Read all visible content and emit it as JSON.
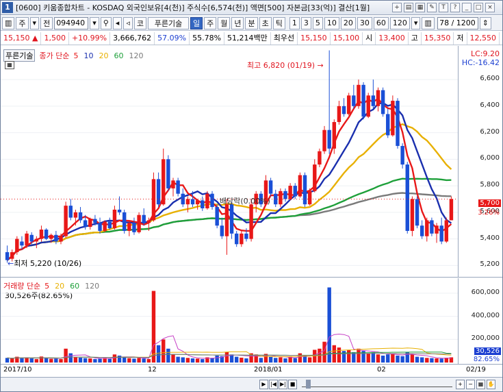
{
  "window": {
    "number": "1",
    "title": "[0600] 키움종합차트 - KOSDAQ 외국인보유[4(천)] 주식수[6,574(천)] 액면[500] 자본금[33(억)] 결산[1월]"
  },
  "toolbar": {
    "market_btn": "주",
    "prev_btn": "전",
    "code": "094940",
    "code_prefix": "코",
    "stock_name": "푸른기술",
    "period_buttons": [
      "일",
      "주",
      "월",
      "년",
      "분",
      "초",
      "틱"
    ],
    "interval_buttons": [
      "1",
      "3",
      "5",
      "10",
      "20",
      "30",
      "60",
      "120"
    ],
    "selected_period": "일",
    "page": "78 / 1200"
  },
  "quote": {
    "price": "15,150",
    "change": "1,500",
    "change_pct": "+10.99%",
    "volume": "3,666,762",
    "vol_ratio1": "57.09%",
    "vol_ratio2": "55.78%",
    "amount": "51,214백만",
    "best_ask_label": "최우선",
    "best_ask": "15,150",
    "best_bid": "15,100",
    "open_label": "시",
    "open": "13,400",
    "high_label": "고",
    "high": "15,350",
    "low_label": "저",
    "low": "12,550"
  },
  "price_pane": {
    "legend_box": "푸른기술",
    "legend_title": "종가 단순",
    "ma_periods": [
      "5",
      "10",
      "20",
      "60",
      "120"
    ],
    "ma_colors": [
      "#e81818",
      "#1a2fae",
      "#e8b000",
      "#1ea03a",
      "#7a7a7a"
    ],
    "lc_label": "LC:9.20",
    "hc_label": "HC:-16.42",
    "high_marker": "최고 6,820 (01/19)",
    "low_marker": "최저 5,220 (10/26)",
    "dividend_marker": "배당락(0.00%)",
    "current_price_tag": "5,700",
    "current_pct_tag": "3.26%",
    "y_ticks": [
      "6,600",
      "6,400",
      "6,200",
      "6,000",
      "5,800",
      "5,600",
      "5,400",
      "5,200"
    ]
  },
  "volume_pane": {
    "legend_title": "거래량 단순",
    "ma_periods": [
      "5",
      "20",
      "60",
      "120"
    ],
    "current_text": "30,526주(82.65%)",
    "current_tag": "30,526",
    "pct_tag": "82.65%",
    "y_ticks": [
      "600,000",
      "400,000",
      "200,000"
    ]
  },
  "x_axis": {
    "labels": [
      "2017/10",
      "12",
      "2018/01",
      "02",
      "02/19"
    ]
  },
  "chart_data": {
    "type": "candlestick",
    "ylim": [
      5150,
      6750
    ],
    "volume_ylim": [
      0,
      700000
    ],
    "candles": [
      [
        5300,
        5350,
        5220,
        5240,
        40000
      ],
      [
        5250,
        5320,
        5230,
        5300,
        35000
      ],
      [
        5300,
        5420,
        5280,
        5400,
        50000
      ],
      [
        5380,
        5420,
        5320,
        5350,
        38000
      ],
      [
        5350,
        5460,
        5330,
        5440,
        45000
      ],
      [
        5430,
        5450,
        5360,
        5380,
        36000
      ],
      [
        5380,
        5420,
        5330,
        5400,
        30000
      ],
      [
        5400,
        5500,
        5380,
        5470,
        52000
      ],
      [
        5470,
        5480,
        5390,
        5400,
        40000
      ],
      [
        5400,
        5440,
        5370,
        5430,
        32000
      ],
      [
        5430,
        5460,
        5360,
        5380,
        34000
      ],
      [
        5380,
        5440,
        5360,
        5420,
        30000
      ],
      [
        5420,
        5680,
        5410,
        5650,
        120000
      ],
      [
        5650,
        5700,
        5540,
        5560,
        80000
      ],
      [
        5560,
        5620,
        5500,
        5600,
        50000
      ],
      [
        5600,
        5640,
        5520,
        5540,
        42000
      ],
      [
        5540,
        5580,
        5470,
        5490,
        38000
      ],
      [
        5490,
        5560,
        5470,
        5550,
        36000
      ],
      [
        5550,
        5580,
        5500,
        5520,
        30000
      ],
      [
        5520,
        5560,
        5440,
        5460,
        34000
      ],
      [
        5460,
        5540,
        5450,
        5530,
        40000
      ],
      [
        5530,
        5560,
        5470,
        5480,
        32000
      ],
      [
        5480,
        5650,
        5470,
        5620,
        70000
      ],
      [
        5620,
        5720,
        5580,
        5600,
        60000
      ],
      [
        5600,
        5620,
        5440,
        5460,
        45000
      ],
      [
        5460,
        5540,
        5420,
        5520,
        38000
      ],
      [
        5520,
        5560,
        5430,
        5450,
        34000
      ],
      [
        5450,
        5600,
        5440,
        5580,
        40000
      ],
      [
        5580,
        5630,
        5500,
        5520,
        35000
      ],
      [
        5520,
        5560,
        5460,
        5540,
        30000
      ],
      [
        5540,
        5900,
        5530,
        5850,
        620000
      ],
      [
        5850,
        5900,
        5640,
        5660,
        150000
      ],
      [
        5660,
        6080,
        5650,
        6000,
        200000
      ],
      [
        6000,
        6030,
        5760,
        5780,
        120000
      ],
      [
        5780,
        5860,
        5720,
        5840,
        70000
      ],
      [
        5840,
        5860,
        5720,
        5740,
        50000
      ],
      [
        5740,
        5780,
        5640,
        5660,
        45000
      ],
      [
        5660,
        5720,
        5600,
        5700,
        40000
      ],
      [
        5700,
        5760,
        5640,
        5660,
        36000
      ],
      [
        5660,
        5700,
        5620,
        5690,
        34000
      ],
      [
        5690,
        5720,
        5610,
        5630,
        30000
      ],
      [
        5630,
        5760,
        5620,
        5740,
        45000
      ],
      [
        5740,
        5760,
        5620,
        5640,
        40000
      ],
      [
        5640,
        5660,
        5480,
        5500,
        60000
      ],
      [
        5500,
        5560,
        5400,
        5420,
        55000
      ],
      [
        5420,
        5700,
        5280,
        5660,
        90000
      ],
      [
        5660,
        5680,
        5400,
        5440,
        70000
      ],
      [
        5440,
        5460,
        5340,
        5360,
        50000
      ],
      [
        5360,
        5460,
        5340,
        5440,
        42000
      ],
      [
        5440,
        5480,
        5380,
        5400,
        36000
      ],
      [
        5400,
        5700,
        5380,
        5660,
        80000
      ],
      [
        5660,
        5760,
        5600,
        5740,
        70000
      ],
      [
        5740,
        5760,
        5640,
        5660,
        40000
      ],
      [
        5660,
        5880,
        5650,
        5840,
        75000
      ],
      [
        5840,
        5860,
        5720,
        5740,
        50000
      ],
      [
        5740,
        5770,
        5640,
        5660,
        40000
      ],
      [
        5660,
        5780,
        5640,
        5760,
        45000
      ],
      [
        5760,
        5780,
        5680,
        5700,
        36000
      ],
      [
        5700,
        5820,
        5690,
        5800,
        50000
      ],
      [
        5800,
        5820,
        5700,
        5720,
        38000
      ],
      [
        5720,
        5900,
        5710,
        5880,
        80000
      ],
      [
        5880,
        5900,
        5640,
        5660,
        60000
      ],
      [
        5660,
        5780,
        5650,
        5760,
        45000
      ],
      [
        5760,
        6000,
        5750,
        5960,
        110000
      ],
      [
        5960,
        6080,
        5940,
        6060,
        120000
      ],
      [
        6060,
        6250,
        6040,
        6220,
        180000
      ],
      [
        6220,
        6820,
        6040,
        6080,
        650000
      ],
      [
        6080,
        6300,
        6040,
        6280,
        150000
      ],
      [
        6280,
        6440,
        6260,
        6400,
        130000
      ],
      [
        6400,
        6460,
        6320,
        6340,
        100000
      ],
      [
        6340,
        6500,
        6330,
        6480,
        110000
      ],
      [
        6480,
        6560,
        6380,
        6400,
        90000
      ],
      [
        6400,
        6600,
        6380,
        6560,
        120000
      ],
      [
        6560,
        6580,
        6300,
        6320,
        100000
      ],
      [
        6320,
        6500,
        6310,
        6480,
        80000
      ],
      [
        6480,
        6600,
        6380,
        6400,
        90000
      ],
      [
        6400,
        6540,
        6360,
        6520,
        70000
      ],
      [
        6520,
        6540,
        6320,
        6340,
        60000
      ],
      [
        6340,
        6380,
        6160,
        6180,
        70000
      ],
      [
        6180,
        6480,
        6170,
        6440,
        80000
      ],
      [
        6440,
        6460,
        6080,
        6100,
        60000
      ],
      [
        6100,
        6120,
        5930,
        5960,
        55000
      ],
      [
        5960,
        5980,
        5440,
        5460,
        90000
      ],
      [
        5460,
        5720,
        5420,
        5700,
        70000
      ],
      [
        5700,
        5720,
        5480,
        5500,
        50000
      ],
      [
        5500,
        5540,
        5400,
        5420,
        45000
      ],
      [
        5420,
        5560,
        5380,
        5540,
        40000
      ],
      [
        5540,
        5560,
        5420,
        5440,
        38000
      ],
      [
        5440,
        5520,
        5370,
        5500,
        36000
      ],
      [
        5500,
        5560,
        5360,
        5380,
        34000
      ],
      [
        5380,
        5560,
        5370,
        5540,
        42000
      ],
      [
        5540,
        5720,
        5540,
        5700,
        45000
      ]
    ]
  }
}
